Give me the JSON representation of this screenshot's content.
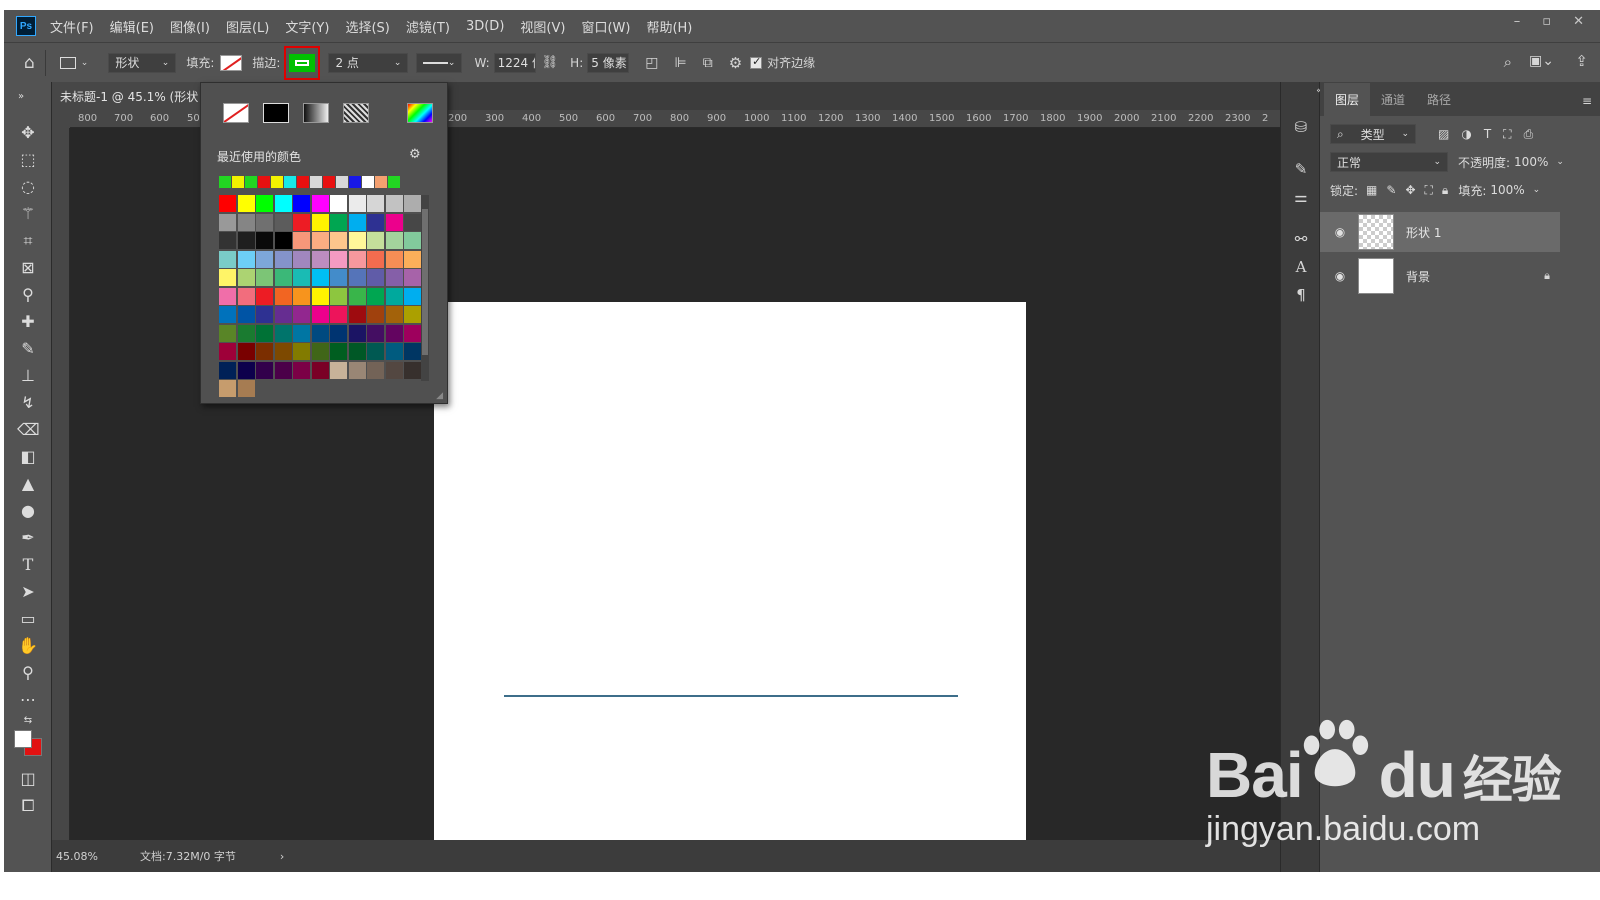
{
  "app": {
    "logo": "Ps",
    "menu": [
      "文件(F)",
      "编辑(E)",
      "图像(I)",
      "图层(L)",
      "文字(Y)",
      "选择(S)",
      "滤镜(T)",
      "3D(D)",
      "视图(V)",
      "窗口(W)",
      "帮助(H)"
    ],
    "window_controls": [
      "–",
      "▫",
      "✕"
    ]
  },
  "options": {
    "mode": "形状",
    "fill_label": "填充:",
    "stroke_label": "描边:",
    "stroke_color": "#00c000",
    "stroke_width": "2 点",
    "w_label": "W:",
    "w_value": "1224 像",
    "h_label": "H:",
    "h_value": "5 像素",
    "align_edges": "对齐边缘"
  },
  "document": {
    "tab_title": "未标题-1 @ 45.1% (形状",
    "ruler_ticks_left": [
      "800",
      "700",
      "600",
      "50"
    ],
    "ruler_ticks_right": [
      "200",
      "300",
      "400",
      "500",
      "600",
      "700",
      "800",
      "900",
      "1000",
      "1100",
      "1200",
      "1300",
      "1400",
      "1500",
      "1600",
      "1700",
      "1800",
      "1900",
      "2000",
      "2100",
      "2200",
      "2300",
      "2"
    ],
    "zoom": "45.08%",
    "doc_info": "文档:7.32M/0 字节"
  },
  "color_picker": {
    "recent_label": "最近使用的颜色",
    "recent_colors": [
      "#22d622",
      "#f2f200",
      "#22d622",
      "#e81010",
      "#f2f200",
      "#18e8e8",
      "#e81010",
      "#d8d8d8",
      "#e81010",
      "#d8d8d8",
      "#1818e8",
      "#ffffff",
      "#f4a070",
      "#22d622"
    ],
    "swatches": [
      "#ff0000",
      "#ffff00",
      "#00ff00",
      "#00ffff",
      "#0000ff",
      "#ff00ff",
      "#ffffff",
      "#ebebeb",
      "#d6d6d6",
      "#c2c2c2",
      "#adadad",
      "#999999",
      "#858585",
      "#707070",
      "#5c5c5c",
      "#ed1c24",
      "#fff200",
      "#00a651",
      "#00aeef",
      "#2e3192",
      "#ec008c",
      "#474747",
      "#333333",
      "#1f1f1f",
      "#0a0a0a",
      "#000000",
      "#f7977a",
      "#fbad82",
      "#fdc68c",
      "#fff799",
      "#c4df9b",
      "#a3d39c",
      "#82ca9c",
      "#7accc8",
      "#6dcff6",
      "#7da7d9",
      "#8493ca",
      "#a187be",
      "#bc8dbf",
      "#f49ac2",
      "#f6989d",
      "#f26c4f",
      "#f68e55",
      "#fbaf5a",
      "#fff467",
      "#acd372",
      "#7cc576",
      "#3bb878",
      "#1abbb4",
      "#00bff3",
      "#438cca",
      "#5574b9",
      "#605ca8",
      "#855fa8",
      "#a763a9",
      "#f06ea9",
      "#f26d7d",
      "#ed1c24",
      "#f26522",
      "#f7941d",
      "#fff200",
      "#8dc63f",
      "#39b54a",
      "#00a651",
      "#00a99d",
      "#00aeef",
      "#0072bc",
      "#0054a5",
      "#2e3192",
      "#662d91",
      "#92278f",
      "#ec008c",
      "#ed145b",
      "#9e0b0f",
      "#a0410d",
      "#a3620a",
      "#aba000",
      "#598527",
      "#1a7b30",
      "#007236",
      "#00746b",
      "#0076a3",
      "#004a80",
      "#003471",
      "#1b1464",
      "#440e62",
      "#630460",
      "#9e005d",
      "#9e0039",
      "#790000",
      "#7b2e00",
      "#7d4900",
      "#827b00",
      "#406618",
      "#005e20",
      "#005826",
      "#005952",
      "#005b7f",
      "#003663",
      "#002157",
      "#0d004c",
      "#32004b",
      "#4b0049",
      "#7b0046",
      "#7a0026",
      "#c7b299",
      "#998675",
      "#736357",
      "#534741",
      "#37302d",
      "#c69c6d",
      "#a67c52"
    ]
  },
  "layers_panel": {
    "tabs": [
      "图层",
      "通道",
      "路径"
    ],
    "filter_kind": "类型",
    "blend_mode": "正常",
    "opacity_label": "不透明度:",
    "opacity_value": "100%",
    "lock_label": "锁定:",
    "fill_label": "填充:",
    "fill_value": "100%",
    "layers": [
      {
        "name": "形状 1",
        "selected": true
      },
      {
        "name": "背景",
        "selected": false
      }
    ]
  },
  "watermark": {
    "brand": "Bai",
    "brand_suffix": "du",
    "brand_cn": "经验",
    "url": "jingyan.baidu.com"
  }
}
